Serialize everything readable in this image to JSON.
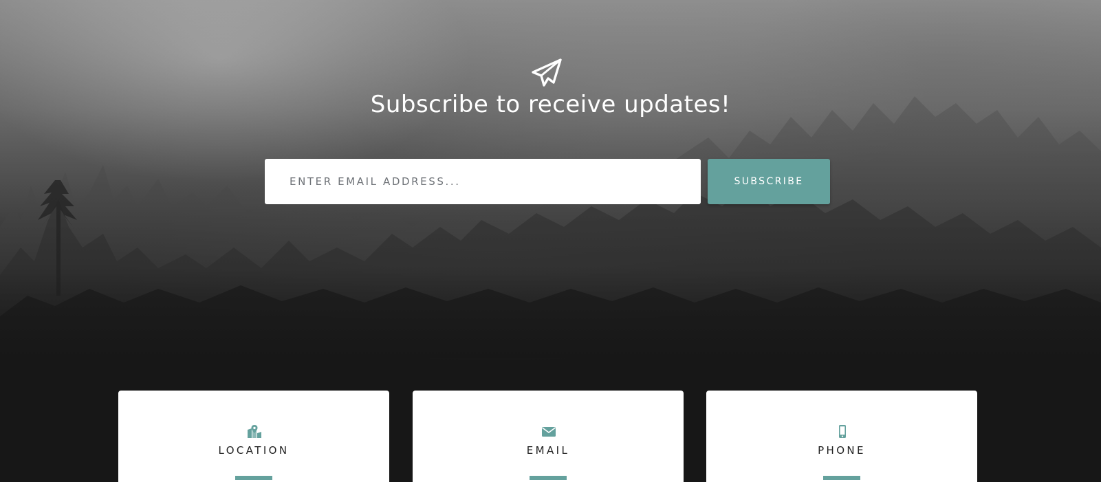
{
  "theme": {
    "accent": "#64a19d",
    "background": "#161616",
    "card_background": "#ffffff"
  },
  "signup": {
    "icon": "paper-plane-icon",
    "title": "Subscribe to receive updates!",
    "email_placeholder": "ENTER EMAIL ADDRESS...",
    "email_value": "",
    "button_label": "SUBSCRIBE"
  },
  "contact": {
    "cards": [
      {
        "icon": "map-location-icon",
        "title": "LOCATION"
      },
      {
        "icon": "envelope-icon",
        "title": "EMAIL"
      },
      {
        "icon": "mobile-phone-icon",
        "title": "PHONE"
      }
    ]
  }
}
